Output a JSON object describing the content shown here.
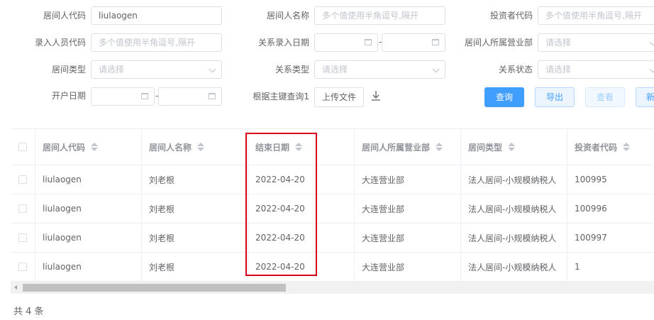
{
  "filters": {
    "broker_code": {
      "label": "居间人代码",
      "value": "liulaogen"
    },
    "broker_name": {
      "label": "居间人名称",
      "placeholder": "多个值使用半角逗号,隔开"
    },
    "investor_code": {
      "label": "投资者代码",
      "placeholder": "多个值使用半角逗号,隔开"
    },
    "entry_user_code": {
      "label": "录入人员代码",
      "placeholder": "多个值使用半角逗号,隔开"
    },
    "relation_entry_date": {
      "label": "关系录入日期",
      "separator": "-"
    },
    "broker_branch": {
      "label": "居间人所属营业部",
      "placeholder": "请选择"
    },
    "broker_type": {
      "label": "居间类型",
      "placeholder": "请选择"
    },
    "relation_type": {
      "label": "关系类型",
      "placeholder": "请选择"
    },
    "relation_status": {
      "label": "关系状态",
      "placeholder": "请选择"
    },
    "open_date": {
      "label": "开户日期",
      "separator": "-"
    },
    "key_query": {
      "label": "根据主键查询1",
      "upload_label": "上传文件"
    }
  },
  "actions": {
    "query": "查询",
    "export": "导出",
    "view": "查看",
    "new": "新"
  },
  "table": {
    "columns": [
      "居间人代码",
      "居间人名称",
      "结束日期",
      "居间人所属营业部",
      "居间类型",
      "投资者代码"
    ],
    "rows": [
      [
        "liulaogen",
        "刘老根",
        "2022-04-20",
        "大连营业部",
        "法人居间-小规模纳税人",
        "100995"
      ],
      [
        "liulaogen",
        "刘老根",
        "2022-04-20",
        "大连营业部",
        "法人居间-小规模纳税人",
        "100996"
      ],
      [
        "liulaogen",
        "刘老根",
        "2022-04-20",
        "大连营业部",
        "法人居间-小规模纳税人",
        "100997"
      ],
      [
        "liulaogen",
        "刘老根",
        "2022-04-20",
        "大连营业部",
        "法人居间-小规模纳税人",
        "1"
      ]
    ],
    "highlight_color": "#d9001b"
  },
  "pagination": {
    "total_text": "共 4 条"
  },
  "colors": {
    "primary": "#409eff",
    "border": "#dcdfe6",
    "text": "#606266"
  }
}
